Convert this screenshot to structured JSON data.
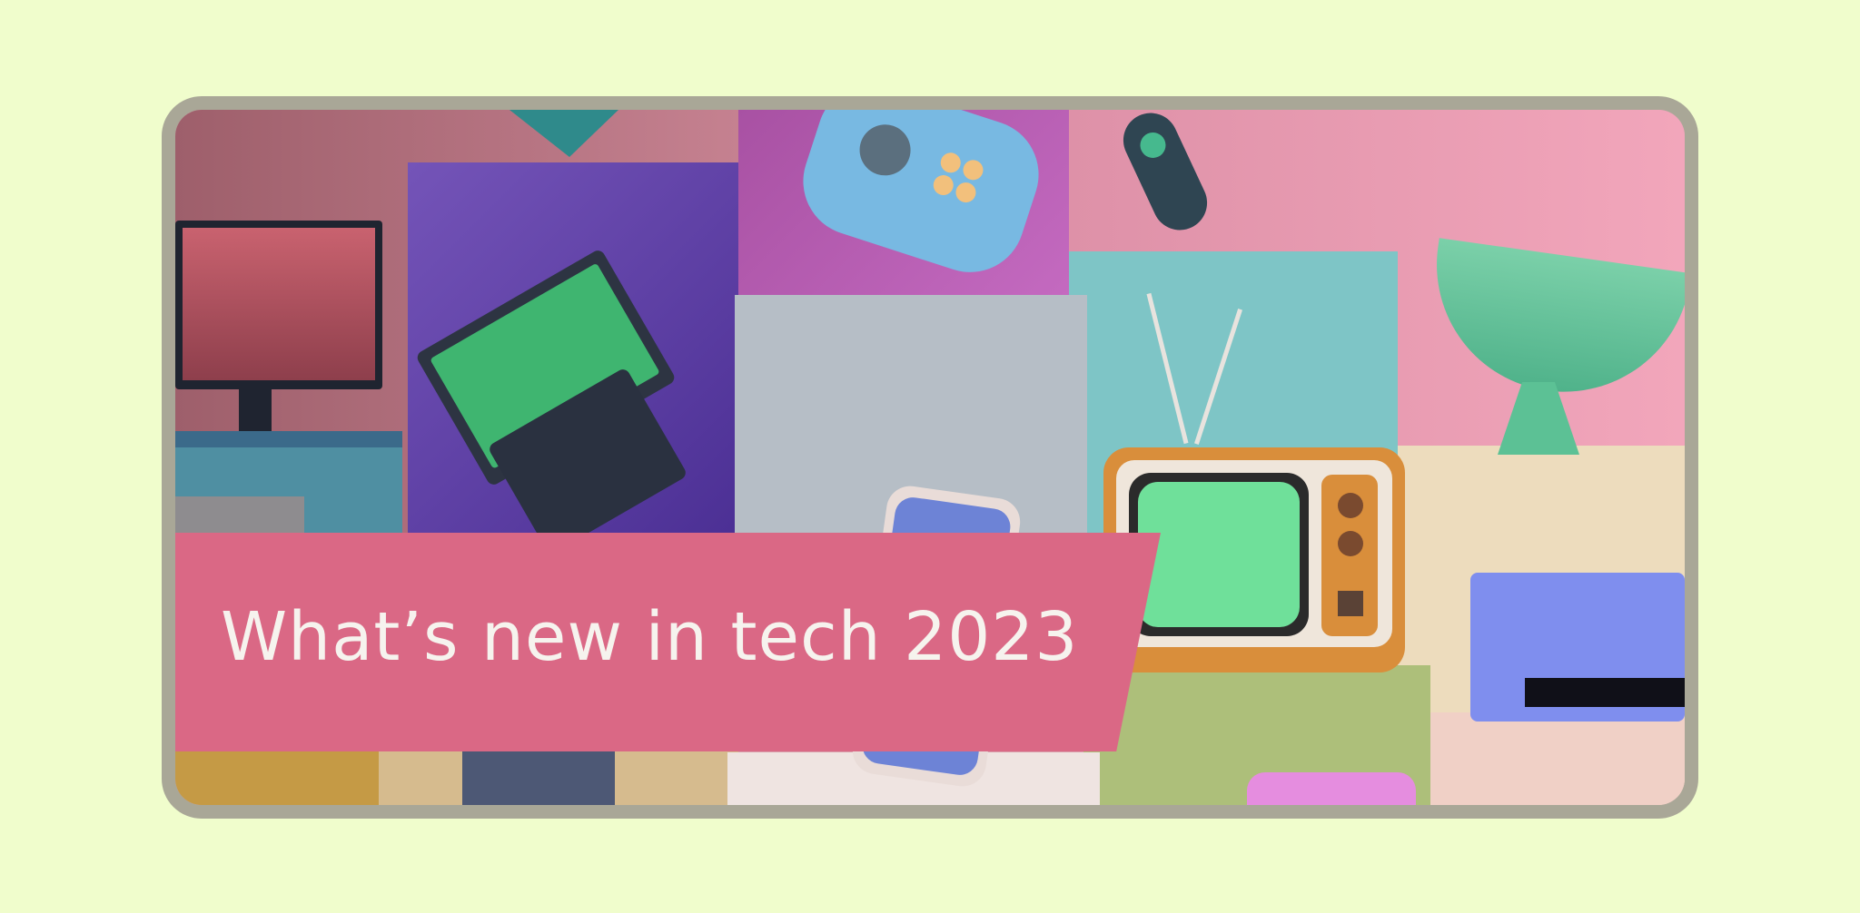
{
  "banner": {
    "title": "What’s new in tech 2023"
  },
  "colors": {
    "page_background": "#f0fdcc",
    "card_border": "#a9a797",
    "banner": "#da6885",
    "banner_text": "#f6f3ee"
  },
  "illustration": {
    "objects": [
      "monitor-icon",
      "laptop-icon",
      "gamepad-icon",
      "vr-controller-icon",
      "retro-tv-icon",
      "satellite-dish-icon",
      "printer-icon",
      "smartphone-icon"
    ]
  }
}
